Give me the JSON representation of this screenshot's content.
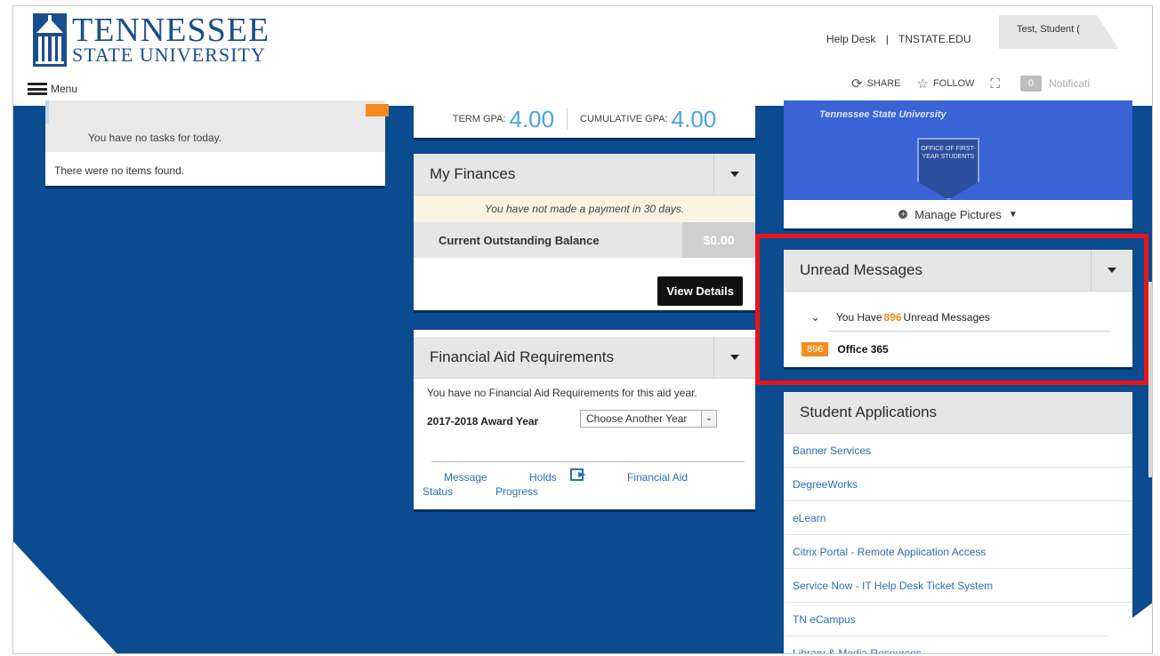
{
  "header": {
    "logo_line1": "TENNESSEE",
    "logo_line2": "STATE UNIVERSITY",
    "menu_label": "Menu",
    "help_desk": "Help Desk",
    "separator": "|",
    "tnstate": "TNSTATE.EDU",
    "user_name": "Test, Student (",
    "share": "SHARE",
    "follow": "FOLLOW",
    "notifications_count": "0",
    "notifications_label": "Notificati"
  },
  "tasks": {
    "no_tasks": "You have no tasks for today.",
    "no_items": "There were no items found."
  },
  "gpa": {
    "term_label": "TERM GPA:",
    "term_value": "4.00",
    "cumulative_label": "CUMULATIVE GPA:",
    "cumulative_value": "4.00"
  },
  "finances": {
    "title": "My Finances",
    "note": "You have not made a payment in 30 days.",
    "balance_label": "Current Outstanding Balance",
    "balance_value": "$0.00",
    "view_details": "View Details"
  },
  "financial_aid": {
    "title": "Financial Aid Requirements",
    "no_requirements": "You have no Financial Aid Requirements for this aid year.",
    "award_year": "2017-2018 Award Year",
    "select_value": "Choose Another Year",
    "link_message": "Message",
    "link_status": "Status",
    "link_holds": "Holds",
    "link_progress": "Progress",
    "link_financial_aid": "Financial Aid"
  },
  "pictures": {
    "banner_text": "Tennessee State University",
    "badge_text": "OFFICE OF FIRST-YEAR STUDENTS",
    "manage_label": "Manage Pictures"
  },
  "unread": {
    "title": "Unread Messages",
    "summary_prefix": "You Have",
    "summary_count": "896",
    "summary_suffix": "Unread Messages",
    "item_count": "896",
    "item_label": "Office 365"
  },
  "applications": {
    "title": "Student Applications",
    "items": [
      "Banner Services",
      "DegreeWorks",
      "eLearn",
      "Citrix Portal - Remote Application Access",
      "Service Now - IT Help Desk Ticket System",
      "TN eCampus",
      "Library & Media Resources"
    ]
  },
  "colors": {
    "page_blue": "#0b4b8f",
    "accent_orange": "#f58a1f",
    "gpa_blue": "#4aa3df",
    "highlight_red": "#e8141a",
    "link_blue": "#2a6ebb"
  }
}
